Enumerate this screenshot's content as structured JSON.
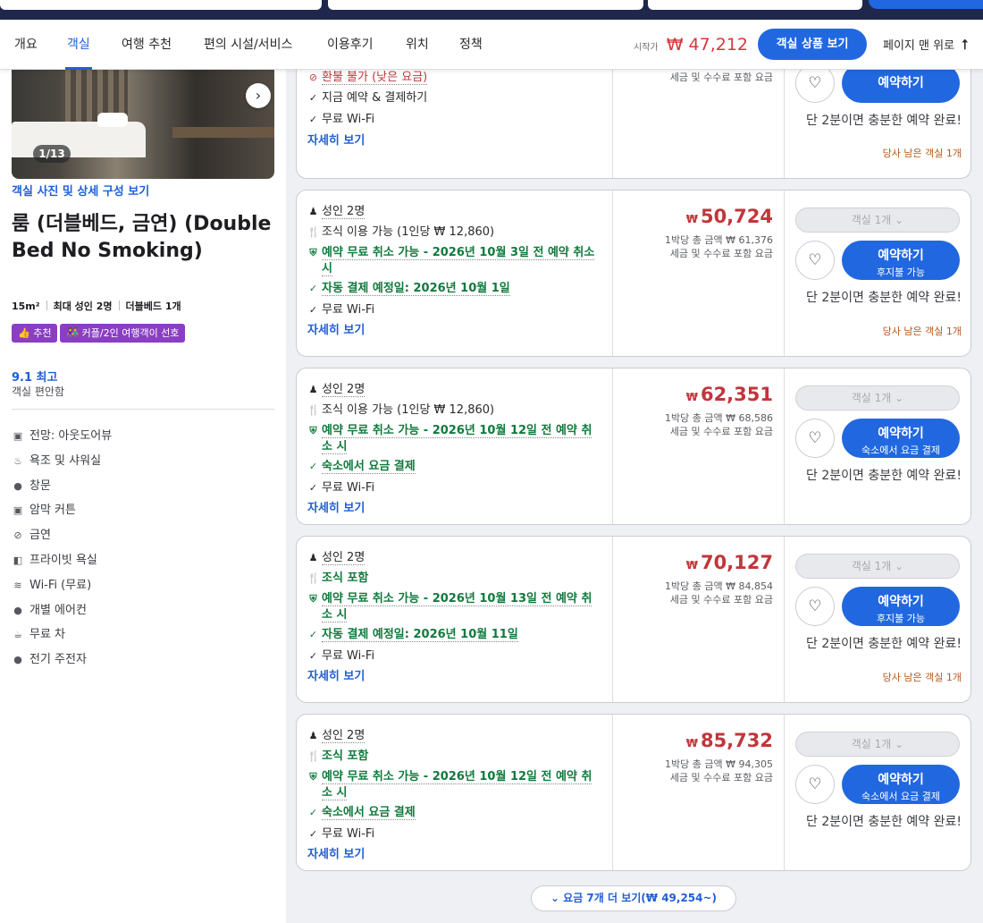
{
  "nav": {
    "tabs": [
      "개요",
      "객실",
      "여행 추천",
      "편의 시설/서비스",
      "이용후기",
      "위치",
      "정책"
    ],
    "start_price_label": "시작가",
    "start_price": "₩ 47,212",
    "view_rooms_button": "객실 상품 보기",
    "back_to_top": "페이지 맨 위로",
    "back_to_top_icon": "arrow-up-icon"
  },
  "room": {
    "photo_counter": "1/13",
    "photo_link": "객실 사진 및 상세 구성 보기",
    "title": "룸 (더블베드, 금연) (Double Bed No Smoking)",
    "size": "15m²",
    "max_guests": "최대 성인 2명",
    "bed": "더블베드 1개",
    "badge_recommend": "추천",
    "badge_couple": "커플/2인 여행객이 선호",
    "score": "9.1 최고",
    "score_sub": "객실 편안함",
    "amenities": [
      "전망: 아웃도어뷰",
      "욕조 및 샤워실",
      "창문",
      "암막 커튼",
      "금연",
      "프라이빗 욕실",
      "Wi-Fi (무료)",
      "개별 에어컨",
      "무료 차",
      "전기 주전자"
    ]
  },
  "common": {
    "tax_note": "세금 및 수수료 포함 요금",
    "details_link": "자세히 보기",
    "room_select": "객실 1개",
    "book_button": "예약하기",
    "quick_note": "단 2분이면 충분한 예약 완료!",
    "last_room": "당사 남은 객실 1개",
    "free_wifi": "무료 Wi-Fi",
    "guests": "성인 2명",
    "currency": "₩"
  },
  "rates": [
    {
      "no_refund": "환불 불가 (낮은 요금)",
      "book_now": "지금 예약 & 결제하기"
    },
    {
      "breakfast": "조식 이용 가능 (1인당 ₩ 12,860)",
      "cancel": "예약 무료 취소 가능 - 2026년 10월 3일 전 예약 취소 시",
      "payment": "자동 결제 예정일: 2026년 10월 1일",
      "price": "50,724",
      "total": "1박당 총 금액 ₩ 61,376",
      "book_sub": "후지불 가능"
    },
    {
      "breakfast": "조식 이용 가능 (1인당 ₩ 12,860)",
      "cancel": "예약 무료 취소 가능 - 2026년 10월 12일 전 예약 취소 시",
      "payment": "숙소에서 요금 결제",
      "price": "62,351",
      "total": "1박당 총 금액 ₩ 68,586",
      "book_sub": "숙소에서 요금 결제"
    },
    {
      "breakfast": "조식 포함",
      "cancel": "예약 무료 취소 가능 - 2026년 10월 13일 전 예약 취소 시",
      "payment": "자동 결제 예정일: 2026년 10월 11일",
      "price": "70,127",
      "total": "1박당 총 금액 ₩ 84,854",
      "book_sub": "후지불 가능"
    },
    {
      "breakfast": "조식 포함",
      "cancel": "예약 무료 취소 가능 - 2026년 10월 12일 전 예약 취소 시",
      "payment": "숙소에서 요금 결제",
      "price": "85,732",
      "total": "1박당 총 금액 ₩ 94,305",
      "book_sub": "숙소에서 요금 결제"
    }
  ],
  "show_more": "요금 7개 더 보기(₩ 49,254~)",
  "colors": {
    "brand_blue": "#2168e0",
    "price_red": "#c0363b",
    "green": "#0f7a3c",
    "badge_purple": "#8a3fc2",
    "urgency": "#b5581a"
  }
}
